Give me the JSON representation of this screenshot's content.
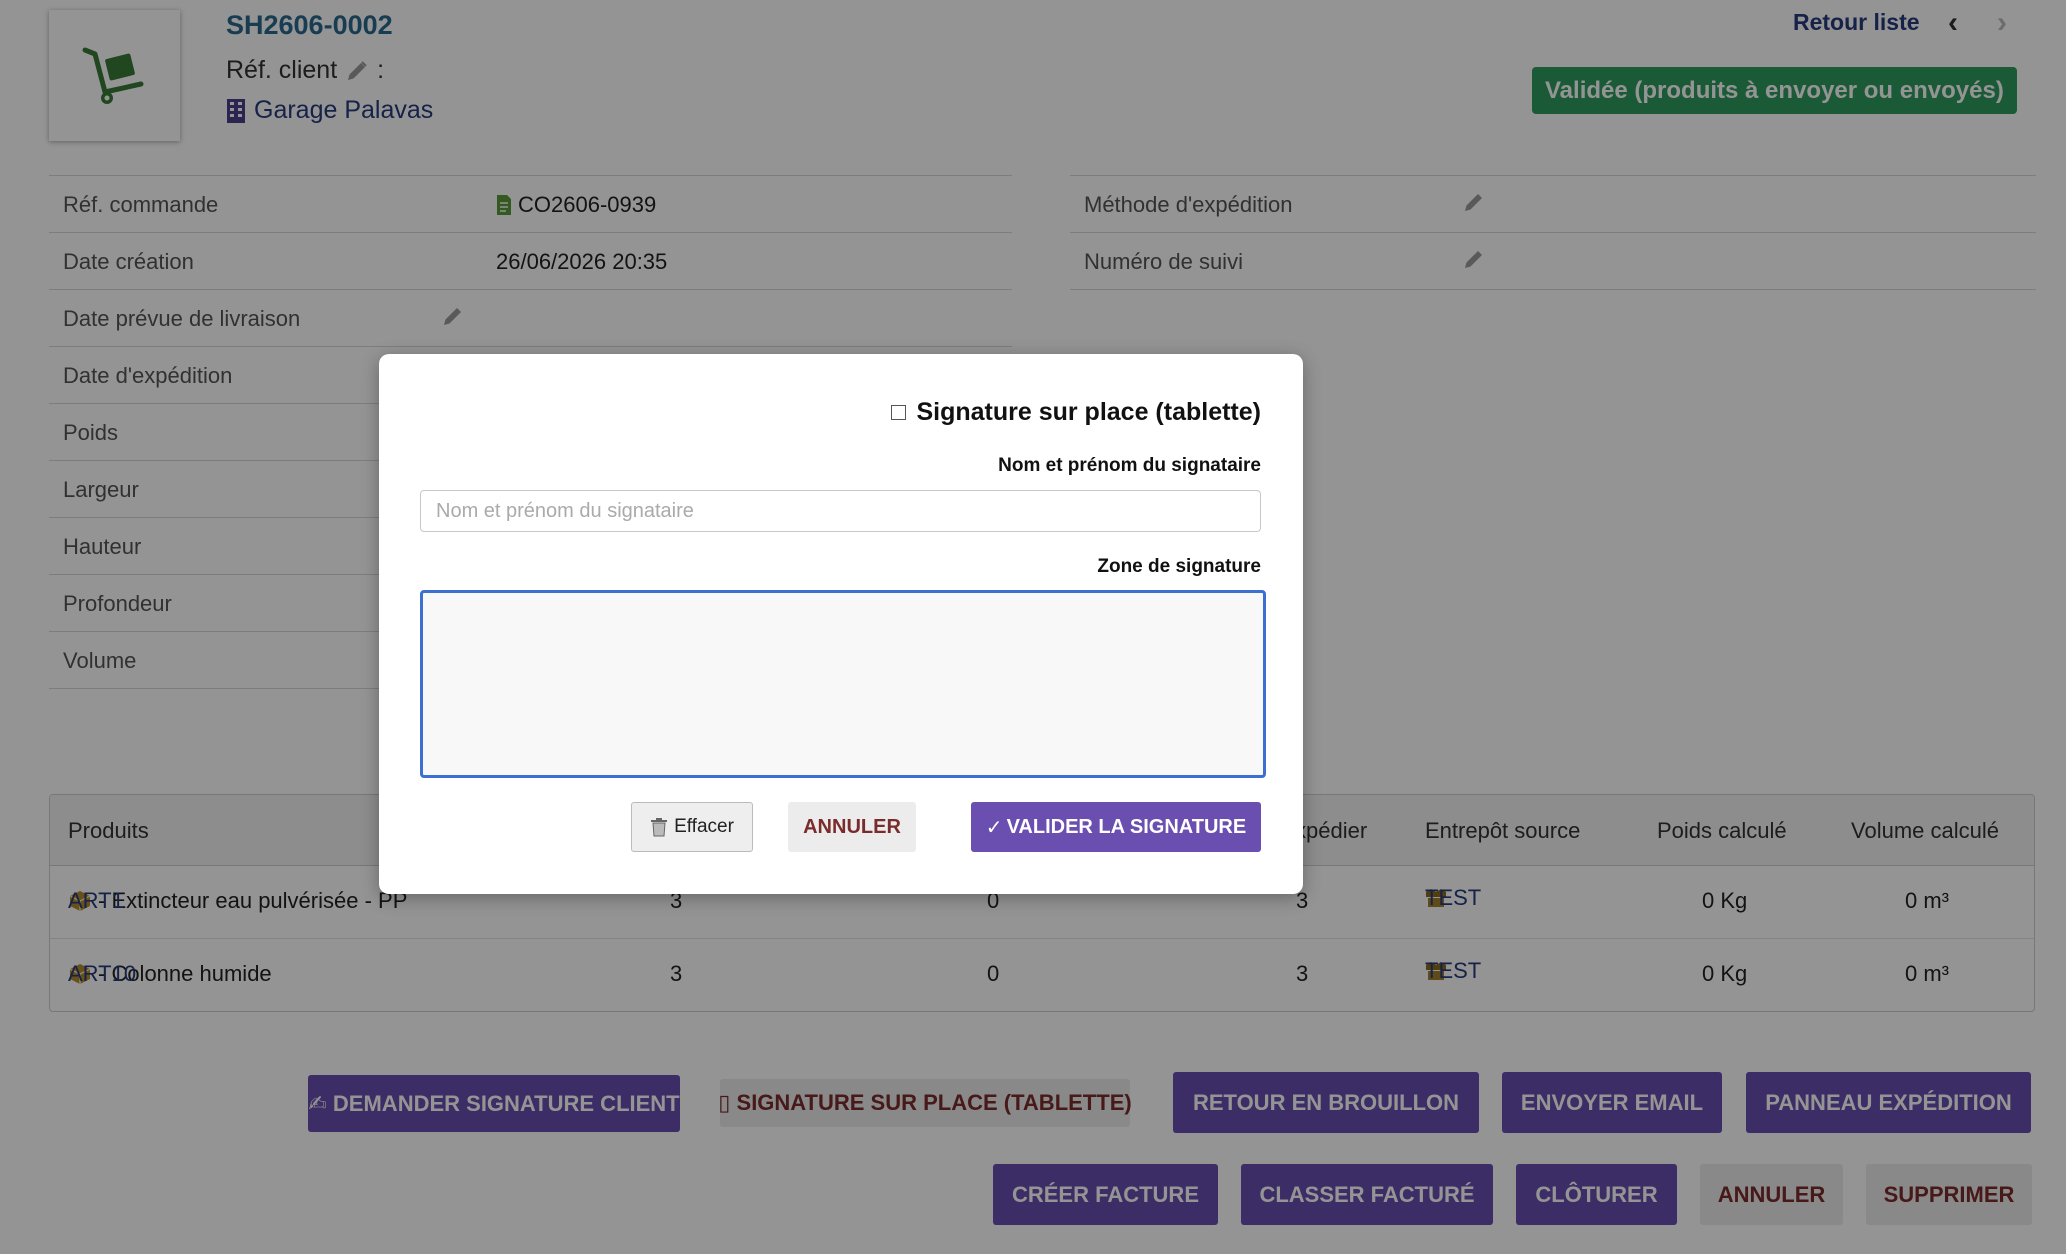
{
  "header": {
    "ref": "SH2606-0002",
    "ref_client_label": "Réf. client",
    "ref_client_colon": ":",
    "thirdparty": "Garage Palavas",
    "back_label": "Retour liste",
    "prev_glyph": "‹",
    "next_glyph": "›",
    "status": "Validée (produits à envoyer ou envoyés)"
  },
  "left_fields": [
    {
      "label": "Réf. commande",
      "value": "CO2606-0939"
    },
    {
      "label": "Date création",
      "value": "26/06/2026 20:35"
    },
    {
      "label": "Date prévue de livraison",
      "value": ""
    },
    {
      "label": "Date d'expédition",
      "value": ""
    },
    {
      "label": "Poids",
      "value": ""
    },
    {
      "label": "Largeur",
      "value": ""
    },
    {
      "label": "Hauteur",
      "value": ""
    },
    {
      "label": "Profondeur",
      "value": ""
    },
    {
      "label": "Volume",
      "value": ""
    }
  ],
  "right_fields": [
    {
      "label": "Méthode d'expédition",
      "value": ""
    },
    {
      "label": "Numéro de suivi",
      "value": ""
    }
  ],
  "products": {
    "headers": [
      "Produits",
      "xpédier",
      "Entrepôt source",
      "Poids calculé",
      "Volume calculé"
    ],
    "rows": [
      {
        "ref": "ART1",
        "desc": " - Extincteur eau pulvérisée - PP",
        "qty_ordered": "3",
        "qty_shipped": "0",
        "qty_to_ship": "3",
        "warehouse": "TEST",
        "weight": "0 Kg",
        "volume": "0 m³"
      },
      {
        "ref": "ART10",
        "desc": " - Colonne humide",
        "qty_ordered": "3",
        "qty_shipped": "0",
        "qty_to_ship": "3",
        "warehouse": "TEST",
        "weight": "0 Kg",
        "volume": "0 m³"
      }
    ]
  },
  "actions": {
    "request_signature": "✍ DEMANDER SIGNATURE CLIENT",
    "onsite_signature": "▯ SIGNATURE SUR PLACE (TABLETTE)",
    "back_to_draft": "RETOUR EN BROUILLON",
    "send_email": "ENVOYER EMAIL",
    "shipping_panel": "PANNEAU EXPÉDITION",
    "create_invoice": "CRÉER FACTURE",
    "classify_billed": "CLASSER FACTURÉ",
    "close": "CLÔTURER",
    "cancel": "ANNULER",
    "delete": "SUPPRIMER"
  },
  "modal": {
    "title": "Signature sur place (tablette)",
    "name_label": "Nom et prénom du signataire",
    "name_placeholder": "Nom et prénom du signataire",
    "name_value": "",
    "zone_label": "Zone de signature",
    "clear_label": "Effacer",
    "cancel_label": "ANNULER",
    "validate_label": "VALIDER LA SIGNATURE",
    "validate_check": "✓"
  },
  "colors": {
    "status_green": "#2f9b5d",
    "primary_purple": "#6a4fb0",
    "link_blue": "#263c7c",
    "focus_blue": "#3b6fd0"
  }
}
